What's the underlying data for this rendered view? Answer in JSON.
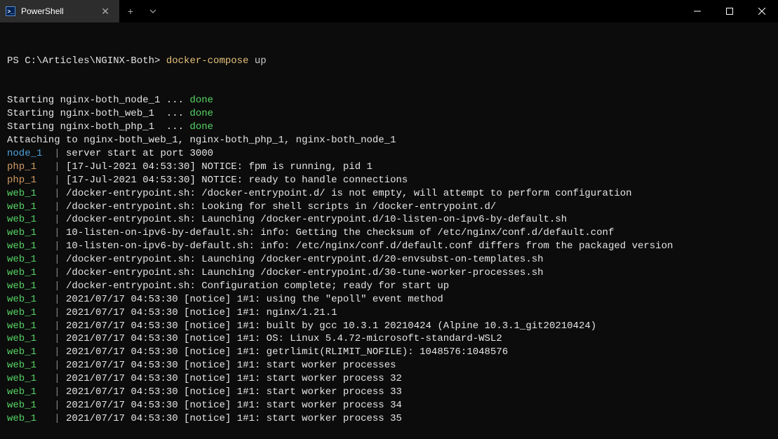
{
  "titlebar": {
    "tab_label": "PowerShell",
    "new_tab": "+",
    "dropdown": "⌄",
    "minimize": "—",
    "maximize": "▢",
    "close": "✕"
  },
  "prompt": {
    "path": "PS C:\\Articles\\NGINX-Both>",
    "command": "docker-compose",
    "arg": "up"
  },
  "lines": [
    {
      "type": "start",
      "text": "Starting nginx-both_node_1 ... ",
      "status": "done"
    },
    {
      "type": "start",
      "text": "Starting nginx-both_web_1  ... ",
      "status": "done"
    },
    {
      "type": "start",
      "text": "Starting nginx-both_php_1  ... ",
      "status": "done"
    },
    {
      "type": "plain",
      "text": "Attaching to nginx-both_web_1, nginx-both_php_1, nginx-both_node_1"
    },
    {
      "type": "log",
      "label": "node_1",
      "color": "blue",
      "text": "server start at port 3000"
    },
    {
      "type": "log",
      "label": "php_1",
      "color": "orange",
      "text": "[17-Jul-2021 04:53:30] NOTICE: fpm is running, pid 1"
    },
    {
      "type": "log",
      "label": "php_1",
      "color": "orange",
      "text": "[17-Jul-2021 04:53:30] NOTICE: ready to handle connections"
    },
    {
      "type": "log",
      "label": "web_1",
      "color": "green",
      "text": "/docker-entrypoint.sh: /docker-entrypoint.d/ is not empty, will attempt to perform configuration"
    },
    {
      "type": "log",
      "label": "web_1",
      "color": "green",
      "text": "/docker-entrypoint.sh: Looking for shell scripts in /docker-entrypoint.d/"
    },
    {
      "type": "log",
      "label": "web_1",
      "color": "green",
      "text": "/docker-entrypoint.sh: Launching /docker-entrypoint.d/10-listen-on-ipv6-by-default.sh"
    },
    {
      "type": "log",
      "label": "web_1",
      "color": "green",
      "text": "10-listen-on-ipv6-by-default.sh: info: Getting the checksum of /etc/nginx/conf.d/default.conf"
    },
    {
      "type": "log",
      "label": "web_1",
      "color": "green",
      "text": "10-listen-on-ipv6-by-default.sh: info: /etc/nginx/conf.d/default.conf differs from the packaged version"
    },
    {
      "type": "log",
      "label": "web_1",
      "color": "green",
      "text": "/docker-entrypoint.sh: Launching /docker-entrypoint.d/20-envsubst-on-templates.sh"
    },
    {
      "type": "log",
      "label": "web_1",
      "color": "green",
      "text": "/docker-entrypoint.sh: Launching /docker-entrypoint.d/30-tune-worker-processes.sh"
    },
    {
      "type": "log",
      "label": "web_1",
      "color": "green",
      "text": "/docker-entrypoint.sh: Configuration complete; ready for start up"
    },
    {
      "type": "log",
      "label": "web_1",
      "color": "green",
      "text": "2021/07/17 04:53:30 [notice] 1#1: using the \"epoll\" event method"
    },
    {
      "type": "log",
      "label": "web_1",
      "color": "green",
      "text": "2021/07/17 04:53:30 [notice] 1#1: nginx/1.21.1"
    },
    {
      "type": "log",
      "label": "web_1",
      "color": "green",
      "text": "2021/07/17 04:53:30 [notice] 1#1: built by gcc 10.3.1 20210424 (Alpine 10.3.1_git20210424)"
    },
    {
      "type": "log",
      "label": "web_1",
      "color": "green",
      "text": "2021/07/17 04:53:30 [notice] 1#1: OS: Linux 5.4.72-microsoft-standard-WSL2"
    },
    {
      "type": "log",
      "label": "web_1",
      "color": "green",
      "text": "2021/07/17 04:53:30 [notice] 1#1: getrlimit(RLIMIT_NOFILE): 1048576:1048576"
    },
    {
      "type": "log",
      "label": "web_1",
      "color": "green",
      "text": "2021/07/17 04:53:30 [notice] 1#1: start worker processes"
    },
    {
      "type": "log",
      "label": "web_1",
      "color": "green",
      "text": "2021/07/17 04:53:30 [notice] 1#1: start worker process 32"
    },
    {
      "type": "log",
      "label": "web_1",
      "color": "green",
      "text": "2021/07/17 04:53:30 [notice] 1#1: start worker process 33"
    },
    {
      "type": "log",
      "label": "web_1",
      "color": "green",
      "text": "2021/07/17 04:53:30 [notice] 1#1: start worker process 34"
    },
    {
      "type": "log",
      "label": "web_1",
      "color": "green",
      "text": "2021/07/17 04:53:30 [notice] 1#1: start worker process 35"
    }
  ]
}
